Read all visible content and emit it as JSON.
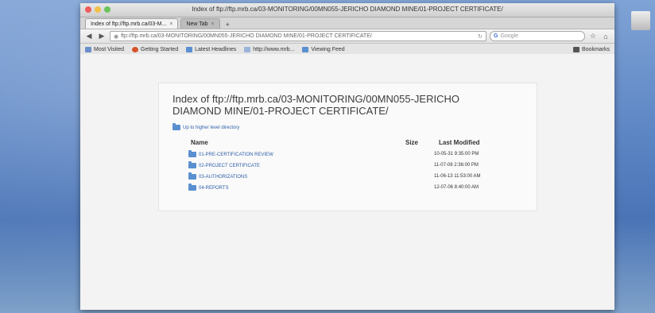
{
  "window": {
    "title": "Index of ftp://ftp.mrb.ca/03-MONITORING/00MN055-JERICHO DIAMOND MINE/01-PROJECT CERTIFICATE/"
  },
  "tabs": [
    {
      "label": "Index of ftp://ftp.mrb.ca/03-M..."
    },
    {
      "label": "New Tab"
    }
  ],
  "nav": {
    "url": "ftp://ftp.mrb.ca/03-MONITORING/00MN055-JERICHO DIAMOND MINE/01-PROJECT CERTIFICATE/",
    "search_placeholder": "Google"
  },
  "bookmarks": {
    "items": [
      {
        "label": "Most Visited",
        "icon": "star-icon"
      },
      {
        "label": "Getting Started",
        "icon": "firefox-icon"
      },
      {
        "label": "Latest Headlines",
        "icon": "rss-icon"
      },
      {
        "label": "http://www.mrb...",
        "icon": "page-icon"
      },
      {
        "label": "Viewing Feed",
        "icon": "feed-icon"
      }
    ],
    "right_label": "Bookmarks"
  },
  "page": {
    "heading": "Index of ftp://ftp.mrb.ca/03-MONITORING/00MN055-JERICHO DIAMOND MINE/01-PROJECT CERTIFICATE/",
    "up_label": "Up to higher level directory",
    "columns": {
      "name": "Name",
      "size": "Size",
      "modified": "Last Modified"
    },
    "rows": [
      {
        "name": "01-PRE-CERTIFICATION REVIEW",
        "date": "10-05-31  9:35:00 PM"
      },
      {
        "name": "02-PROJECT CERTIFICATE",
        "date": "11-07-08  2:36:00 PM"
      },
      {
        "name": "03-AUTHORIZATIONS",
        "date": "11-06-13  11:53:00 AM"
      },
      {
        "name": "04-REPORTS",
        "date": "12-07-06  8:40:00 AM"
      }
    ]
  },
  "colors": {
    "link": "#2e5fa8",
    "folder": "#5a8fd0",
    "desktop": "#5b84c3"
  }
}
